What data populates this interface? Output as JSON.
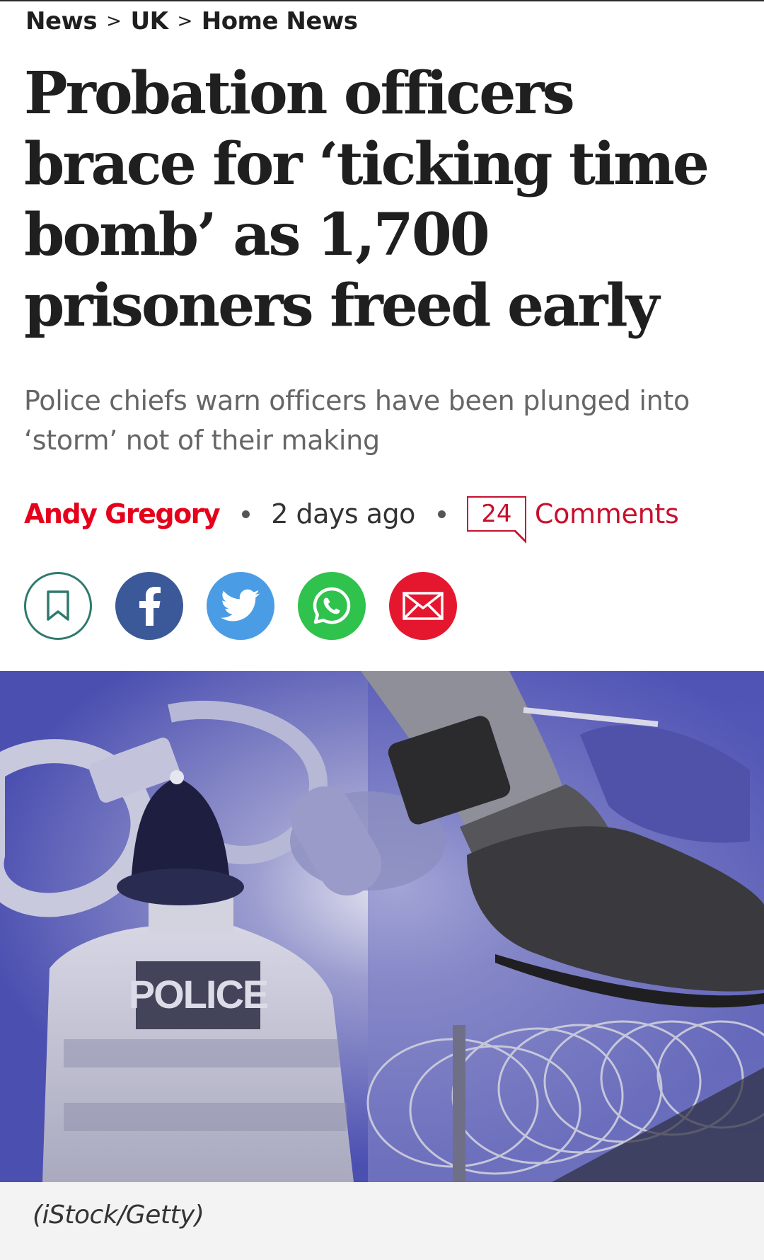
{
  "breadcrumb": {
    "items": [
      "News",
      "UK",
      "Home News"
    ],
    "separator": ">"
  },
  "article": {
    "headline": "Probation officers brace for ‘ticking time bomb’ as 1,700 prisoners freed early",
    "standfirst": "Police chiefs warn officers have been plunged into ‘storm’ not of their making",
    "author": "Andy Gregory",
    "time": "2 days ago",
    "comments_count": "24",
    "comments_label": "Comments"
  },
  "share": {
    "buttons": [
      {
        "name": "bookmark-icon",
        "color": "#2f7a6e"
      },
      {
        "name": "facebook-icon",
        "color": "#3b5998"
      },
      {
        "name": "twitter-icon",
        "color": "#4a9de4"
      },
      {
        "name": "whatsapp-icon",
        "color": "#2fc24c"
      },
      {
        "name": "email-icon",
        "color": "#e5172f"
      }
    ]
  },
  "hero": {
    "police_text": "POLICE",
    "caption": "(iStock/Getty)"
  },
  "colors": {
    "accent": "#e5001c",
    "comments": "#c8102e",
    "hero_tint": "#5b5fc4"
  }
}
